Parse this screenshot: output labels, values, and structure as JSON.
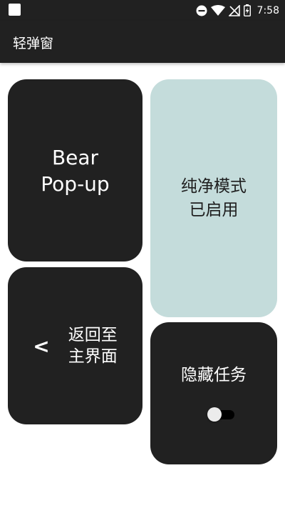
{
  "status_bar": {
    "time": "7:58",
    "icons": [
      "dnd-icon",
      "wifi-icon",
      "no-sim-icon",
      "battery-charging-icon"
    ]
  },
  "app_bar": {
    "title": "轻弹窗"
  },
  "tiles": {
    "bear": {
      "line1": "Bear",
      "line2": "Pop-up"
    },
    "pure_mode": {
      "line1": "纯净模式",
      "line2": "已启用"
    },
    "home": {
      "arrow": "<",
      "line1": "返回至",
      "line2": "主界面"
    },
    "hide_task": {
      "label": "隐藏任务",
      "toggle_on": false
    }
  },
  "colors": {
    "dark_tile": "#212121",
    "light_tile": "#c4dcdb",
    "background": "#ffffff"
  }
}
